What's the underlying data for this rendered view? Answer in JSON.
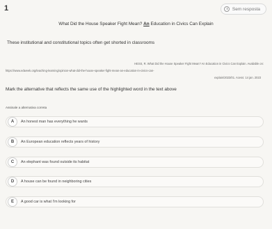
{
  "question": {
    "number": "1",
    "status": "Sem resposta",
    "title_before": "What Did the House Speaker Fight Mean?",
    "title_highlight": "An",
    "title_after": "Education in Civics Can Explain",
    "intro": "These institutional and constitutional topics often get shorted in classrooms",
    "reference_line1": "HESS, R. What Did the House Speaker Fight Mean? An Education in Civics Can Explain. Available on:",
    "reference_line2": "https://www.edweek.org/teaching-learning/opinion-what-did-the-house-speaker-fight-mean-an-education-in-civics-can-",
    "reference_line3": "explain/2023/01. Acess: 14 jan. 2023",
    "prompt": "Mark the alternative that reflects the same use of the highlighted word in the text above",
    "instruction": "Assinale a alternativa correta"
  },
  "options": [
    {
      "letter": "A",
      "text": "An honest man has everything he wants"
    },
    {
      "letter": "B",
      "text": "An European education reflects years of history"
    },
    {
      "letter": "C",
      "text": "An elephant was found outside its habitat"
    },
    {
      "letter": "D",
      "text": "A house can be found in neighboring cities"
    },
    {
      "letter": "E",
      "text": "A good car is what I'm looking for"
    }
  ],
  "icons": {
    "status": "clock-icon"
  }
}
